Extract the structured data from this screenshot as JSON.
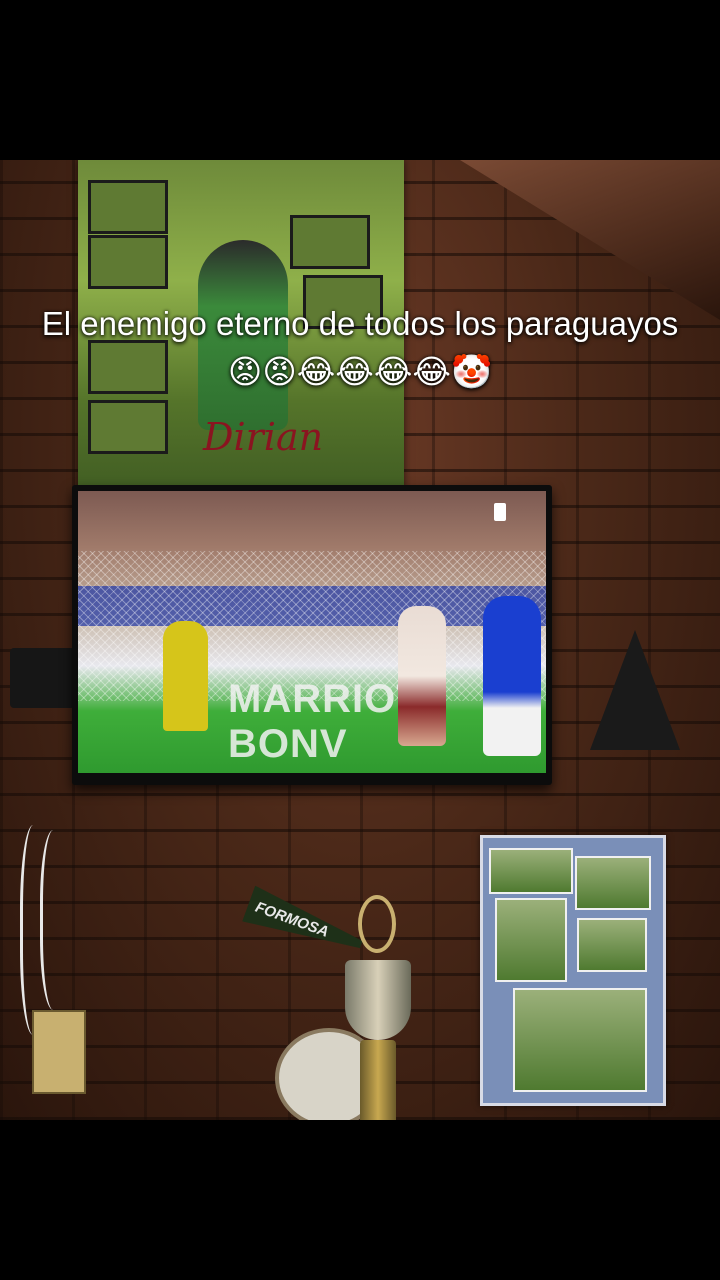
{
  "caption": {
    "text": "El enemigo eterno de todos los paraguayos 😡😡😂😂😂😂🤡"
  },
  "poster": {
    "signature": "Dirian"
  },
  "tv_screen": {
    "ad_board_text": "MARRIOTT BONV"
  },
  "pennant": {
    "text": "FORMOSA"
  }
}
